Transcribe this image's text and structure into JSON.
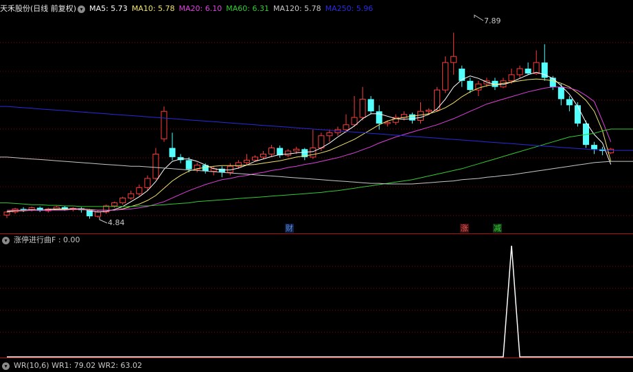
{
  "main_header": {
    "stock_name": "天禾股份(日线 前复权)",
    "ma": [
      {
        "label": "MA5: ",
        "value": "5.73",
        "color": "#ffffff"
      },
      {
        "label": "MA10: ",
        "value": "5.78",
        "color": "#f2e56b"
      },
      {
        "label": "MA20: ",
        "value": "6.10",
        "color": "#e040e0"
      },
      {
        "label": "MA60: ",
        "value": "6.31",
        "color": "#33cc33"
      },
      {
        "label": "MA120: ",
        "value": "5.78",
        "color": "#c8c8c8"
      },
      {
        "label": "MA250: ",
        "value": "5.96",
        "color": "#2a2adf"
      }
    ]
  },
  "price_annotations": {
    "high": "7.89",
    "low": "4.84"
  },
  "event_markers": [
    {
      "text": "财",
      "color": "#5b8bd6",
      "bg": "#10204a"
    },
    {
      "text": "涨",
      "color": "#e05a5a",
      "bg": "#4a1010"
    },
    {
      "text": "减",
      "color": "#3cc83c",
      "bg": "#103a10"
    }
  ],
  "indicator_header": {
    "name": "涨停进行曲F",
    "separator": " : ",
    "value": "0.00"
  },
  "bottom_header": {
    "text": "WR(10,6)  WR1: 79.02  WR2: 63.02"
  },
  "colors": {
    "up": "#ff3c3c",
    "down": "#54ffff",
    "grid": "#8b0000",
    "indicator": "#ffffff"
  },
  "chart_data": {
    "type": "candlestick",
    "price_range": [
      4.6,
      8.2
    ],
    "high": 7.89,
    "low": 4.84,
    "candles": [
      [
        4.9,
        4.95,
        4.85,
        4.96
      ],
      [
        4.95,
        5.0,
        4.92,
        5.02
      ],
      [
        5.0,
        4.98,
        4.95,
        5.03
      ],
      [
        4.98,
        5.02,
        4.96,
        5.04
      ],
      [
        5.02,
        4.97,
        4.95,
        5.04
      ],
      [
        4.97,
        5.0,
        4.94,
        5.02
      ],
      [
        5.0,
        5.03,
        4.98,
        5.05
      ],
      [
        5.03,
        4.99,
        4.97,
        5.05
      ],
      [
        4.99,
        5.01,
        4.96,
        5.03
      ],
      [
        5.01,
        4.98,
        4.94,
        5.03
      ],
      [
        4.98,
        4.88,
        4.84,
        5.0
      ],
      [
        4.88,
        4.95,
        4.86,
        4.98
      ],
      [
        4.95,
        5.05,
        4.92,
        5.07
      ],
      [
        5.05,
        5.1,
        5.02,
        5.12
      ],
      [
        5.1,
        5.18,
        5.07,
        5.2
      ],
      [
        5.18,
        5.25,
        5.15,
        5.3
      ],
      [
        5.25,
        5.35,
        5.22,
        5.4
      ],
      [
        5.35,
        5.5,
        5.3,
        5.55
      ],
      [
        5.5,
        5.9,
        5.48,
        6.0
      ],
      [
        6.15,
        6.6,
        6.1,
        6.68
      ],
      [
        6.0,
        5.85,
        5.8,
        6.25
      ],
      [
        5.85,
        5.8,
        5.75,
        5.9
      ],
      [
        5.8,
        5.65,
        5.6,
        5.85
      ],
      [
        5.65,
        5.72,
        5.6,
        5.76
      ],
      [
        5.72,
        5.62,
        5.58,
        5.75
      ],
      [
        5.62,
        5.66,
        5.55,
        5.7
      ],
      [
        5.66,
        5.6,
        5.52,
        5.7
      ],
      [
        5.6,
        5.7,
        5.55,
        5.75
      ],
      [
        5.7,
        5.76,
        5.66,
        5.8
      ],
      [
        5.76,
        5.8,
        5.72,
        5.9
      ],
      [
        5.8,
        5.85,
        5.78,
        5.88
      ],
      [
        5.85,
        5.9,
        5.82,
        5.95
      ],
      [
        5.9,
        6.0,
        5.85,
        6.05
      ],
      [
        6.0,
        5.88,
        5.84,
        6.04
      ],
      [
        5.88,
        5.95,
        5.85,
        5.98
      ],
      [
        5.95,
        5.98,
        5.9,
        6.02
      ],
      [
        5.98,
        5.85,
        5.8,
        6.0
      ],
      [
        5.85,
        6.0,
        5.82,
        6.3
      ],
      [
        6.0,
        6.2,
        5.95,
        6.25
      ],
      [
        6.2,
        6.25,
        6.1,
        6.3
      ],
      [
        6.25,
        6.3,
        6.2,
        6.35
      ],
      [
        6.3,
        6.38,
        6.25,
        6.55
      ],
      [
        6.38,
        6.5,
        6.35,
        6.85
      ],
      [
        6.5,
        6.8,
        6.45,
        7.0
      ],
      [
        6.8,
        6.6,
        6.55,
        6.85
      ],
      [
        6.6,
        6.4,
        6.3,
        6.7
      ],
      [
        6.4,
        6.42,
        6.35,
        6.45
      ],
      [
        6.42,
        6.5,
        6.38,
        6.55
      ],
      [
        6.5,
        6.55,
        6.45,
        6.6
      ],
      [
        6.55,
        6.45,
        6.4,
        6.58
      ],
      [
        6.45,
        6.6,
        6.4,
        6.75
      ],
      [
        6.6,
        6.62,
        6.55,
        6.65
      ],
      [
        6.62,
        6.95,
        6.6,
        7.0
      ],
      [
        6.95,
        7.4,
        6.9,
        7.5
      ],
      [
        7.4,
        7.5,
        7.2,
        7.89
      ],
      [
        7.3,
        7.1,
        7.0,
        7.35
      ],
      [
        7.1,
        6.95,
        6.9,
        7.15
      ],
      [
        6.95,
        7.05,
        6.85,
        7.1
      ],
      [
        7.05,
        7.1,
        7.0,
        7.15
      ],
      [
        7.1,
        7.0,
        6.95,
        7.15
      ],
      [
        7.0,
        7.1,
        6.98,
        7.15
      ],
      [
        7.1,
        7.2,
        7.05,
        7.3
      ],
      [
        7.2,
        7.3,
        7.15,
        7.35
      ],
      [
        7.3,
        7.22,
        7.2,
        7.4
      ],
      [
        7.22,
        7.4,
        7.2,
        7.6
      ],
      [
        7.4,
        7.15,
        7.1,
        7.7
      ],
      [
        7.15,
        7.0,
        6.95,
        7.18
      ],
      [
        7.0,
        6.8,
        6.7,
        7.05
      ],
      [
        6.8,
        6.7,
        6.6,
        6.85
      ],
      [
        6.7,
        6.4,
        6.35,
        6.75
      ],
      [
        6.4,
        6.05,
        6.0,
        6.45
      ],
      [
        6.05,
        5.98,
        5.9,
        6.1
      ],
      [
        5.98,
        5.95,
        5.88,
        6.02
      ],
      [
        5.92,
        5.98,
        5.9,
        6.0
      ]
    ],
    "ma_series": [
      {
        "name": "MA5",
        "values": [
          4.95,
          4.97,
          4.98,
          4.99,
          4.98,
          4.99,
          5.0,
          5.0,
          5.0,
          5.0,
          4.97,
          4.95,
          4.96,
          4.99,
          5.04,
          5.12,
          5.2,
          5.3,
          5.45,
          5.65,
          5.78,
          5.82,
          5.82,
          5.78,
          5.72,
          5.66,
          5.64,
          5.64,
          5.67,
          5.72,
          5.78,
          5.82,
          5.86,
          5.89,
          5.9,
          5.92,
          5.93,
          5.94,
          6.0,
          6.08,
          6.18,
          6.27,
          6.36,
          6.48,
          6.56,
          6.56,
          6.52,
          6.48,
          6.47,
          6.48,
          6.5,
          6.55,
          6.64,
          6.8,
          7.0,
          7.12,
          7.18,
          7.14,
          7.08,
          7.04,
          7.04,
          7.08,
          7.14,
          7.2,
          7.24,
          7.2,
          7.14,
          7.02,
          6.88,
          6.68,
          6.42,
          6.22,
          6.08,
          5.73
        ]
      },
      {
        "name": "MA10",
        "values": [
          4.96,
          4.97,
          4.97,
          4.98,
          4.98,
          4.98,
          4.99,
          4.99,
          5.0,
          5.0,
          4.99,
          4.98,
          4.98,
          4.98,
          5.0,
          5.04,
          5.08,
          5.14,
          5.22,
          5.34,
          5.46,
          5.55,
          5.62,
          5.66,
          5.68,
          5.7,
          5.71,
          5.71,
          5.71,
          5.72,
          5.73,
          5.75,
          5.77,
          5.79,
          5.82,
          5.85,
          5.87,
          5.89,
          5.92,
          5.96,
          6.02,
          6.08,
          6.14,
          6.22,
          6.3,
          6.38,
          6.44,
          6.48,
          6.5,
          6.52,
          6.54,
          6.56,
          6.6,
          6.66,
          6.74,
          6.84,
          6.92,
          6.98,
          7.02,
          7.04,
          7.06,
          7.08,
          7.1,
          7.12,
          7.13,
          7.12,
          7.1,
          7.06,
          7.0,
          6.9,
          6.78,
          6.6,
          6.28,
          5.78
        ]
      },
      {
        "name": "MA20",
        "values": [
          4.98,
          4.98,
          4.98,
          4.98,
          4.98,
          4.98,
          4.98,
          4.98,
          4.99,
          4.99,
          4.98,
          4.98,
          4.98,
          4.98,
          4.99,
          5.0,
          5.02,
          5.04,
          5.08,
          5.12,
          5.18,
          5.24,
          5.3,
          5.35,
          5.4,
          5.44,
          5.48,
          5.5,
          5.53,
          5.55,
          5.58,
          5.6,
          5.63,
          5.65,
          5.68,
          5.7,
          5.73,
          5.75,
          5.78,
          5.81,
          5.84,
          5.88,
          5.92,
          5.97,
          6.02,
          6.08,
          6.13,
          6.18,
          6.22,
          6.26,
          6.3,
          6.34,
          6.38,
          6.43,
          6.48,
          6.54,
          6.6,
          6.66,
          6.72,
          6.76,
          6.8,
          6.84,
          6.88,
          6.92,
          6.95,
          6.98,
          7.0,
          7.0,
          6.98,
          6.94,
          6.86,
          6.76,
          6.44,
          6.1
        ]
      },
      {
        "name": "MA60",
        "values": [
          5.1,
          5.09,
          5.08,
          5.07,
          5.07,
          5.06,
          5.06,
          5.05,
          5.05,
          5.04,
          5.04,
          5.04,
          5.04,
          5.04,
          5.04,
          5.04,
          5.05,
          5.05,
          5.06,
          5.07,
          5.08,
          5.09,
          5.1,
          5.12,
          5.13,
          5.14,
          5.15,
          5.16,
          5.17,
          5.18,
          5.19,
          5.2,
          5.21,
          5.22,
          5.23,
          5.24,
          5.25,
          5.26,
          5.27,
          5.29,
          5.3,
          5.32,
          5.34,
          5.36,
          5.38,
          5.4,
          5.42,
          5.44,
          5.46,
          5.48,
          5.51,
          5.54,
          5.57,
          5.6,
          5.63,
          5.66,
          5.7,
          5.74,
          5.78,
          5.82,
          5.86,
          5.9,
          5.94,
          5.98,
          6.02,
          6.06,
          6.1,
          6.14,
          6.18,
          6.2,
          6.22,
          6.24,
          6.28,
          6.31
        ]
      },
      {
        "name": "MA120",
        "values": [
          5.85,
          5.84,
          5.83,
          5.82,
          5.81,
          5.8,
          5.79,
          5.78,
          5.77,
          5.76,
          5.75,
          5.74,
          5.73,
          5.72,
          5.71,
          5.7,
          5.7,
          5.69,
          5.68,
          5.67,
          5.66,
          5.65,
          5.64,
          5.63,
          5.62,
          5.61,
          5.6,
          5.59,
          5.58,
          5.57,
          5.56,
          5.55,
          5.54,
          5.53,
          5.52,
          5.51,
          5.5,
          5.49,
          5.48,
          5.47,
          5.46,
          5.45,
          5.44,
          5.43,
          5.42,
          5.42,
          5.41,
          5.41,
          5.41,
          5.41,
          5.42,
          5.43,
          5.44,
          5.45,
          5.46,
          5.48,
          5.49,
          5.5,
          5.52,
          5.53,
          5.55,
          5.56,
          5.58,
          5.6,
          5.62,
          5.64,
          5.66,
          5.68,
          5.7,
          5.72,
          5.74,
          5.76,
          5.77,
          5.78
        ]
      },
      {
        "name": "MA250",
        "values": [
          6.68,
          6.67,
          6.66,
          6.65,
          6.64,
          6.63,
          6.62,
          6.61,
          6.6,
          6.59,
          6.58,
          6.57,
          6.56,
          6.55,
          6.54,
          6.53,
          6.52,
          6.51,
          6.5,
          6.49,
          6.48,
          6.47,
          6.46,
          6.45,
          6.44,
          6.43,
          6.42,
          6.41,
          6.4,
          6.39,
          6.38,
          6.37,
          6.36,
          6.35,
          6.34,
          6.33,
          6.32,
          6.31,
          6.3,
          6.29,
          6.28,
          6.27,
          6.26,
          6.25,
          6.24,
          6.23,
          6.22,
          6.21,
          6.2,
          6.19,
          6.18,
          6.17,
          6.16,
          6.15,
          6.14,
          6.13,
          6.12,
          6.11,
          6.1,
          6.09,
          6.08,
          6.07,
          6.06,
          6.05,
          6.04,
          6.03,
          6.02,
          6.01,
          6.0,
          5.99,
          5.98,
          5.97,
          5.97,
          5.96
        ]
      }
    ],
    "indicator": {
      "name": "涨停进行曲F",
      "range": [
        0,
        1
      ],
      "values": [
        0,
        0,
        0,
        0,
        0,
        0,
        0,
        0,
        0,
        0,
        0,
        0,
        0,
        0,
        0,
        0,
        0,
        0,
        0,
        0,
        0,
        0,
        0,
        0,
        0,
        0,
        0,
        0,
        0,
        0,
        0,
        0,
        0,
        0,
        0,
        0,
        0,
        0,
        0,
        0,
        0,
        0,
        0,
        0,
        0,
        0,
        0,
        0,
        0,
        0,
        0,
        0,
        0,
        0,
        0,
        0,
        0,
        0,
        0,
        0,
        0,
        1,
        0,
        0,
        0,
        0,
        0,
        0,
        0,
        0,
        0,
        0,
        0,
        0
      ]
    }
  }
}
